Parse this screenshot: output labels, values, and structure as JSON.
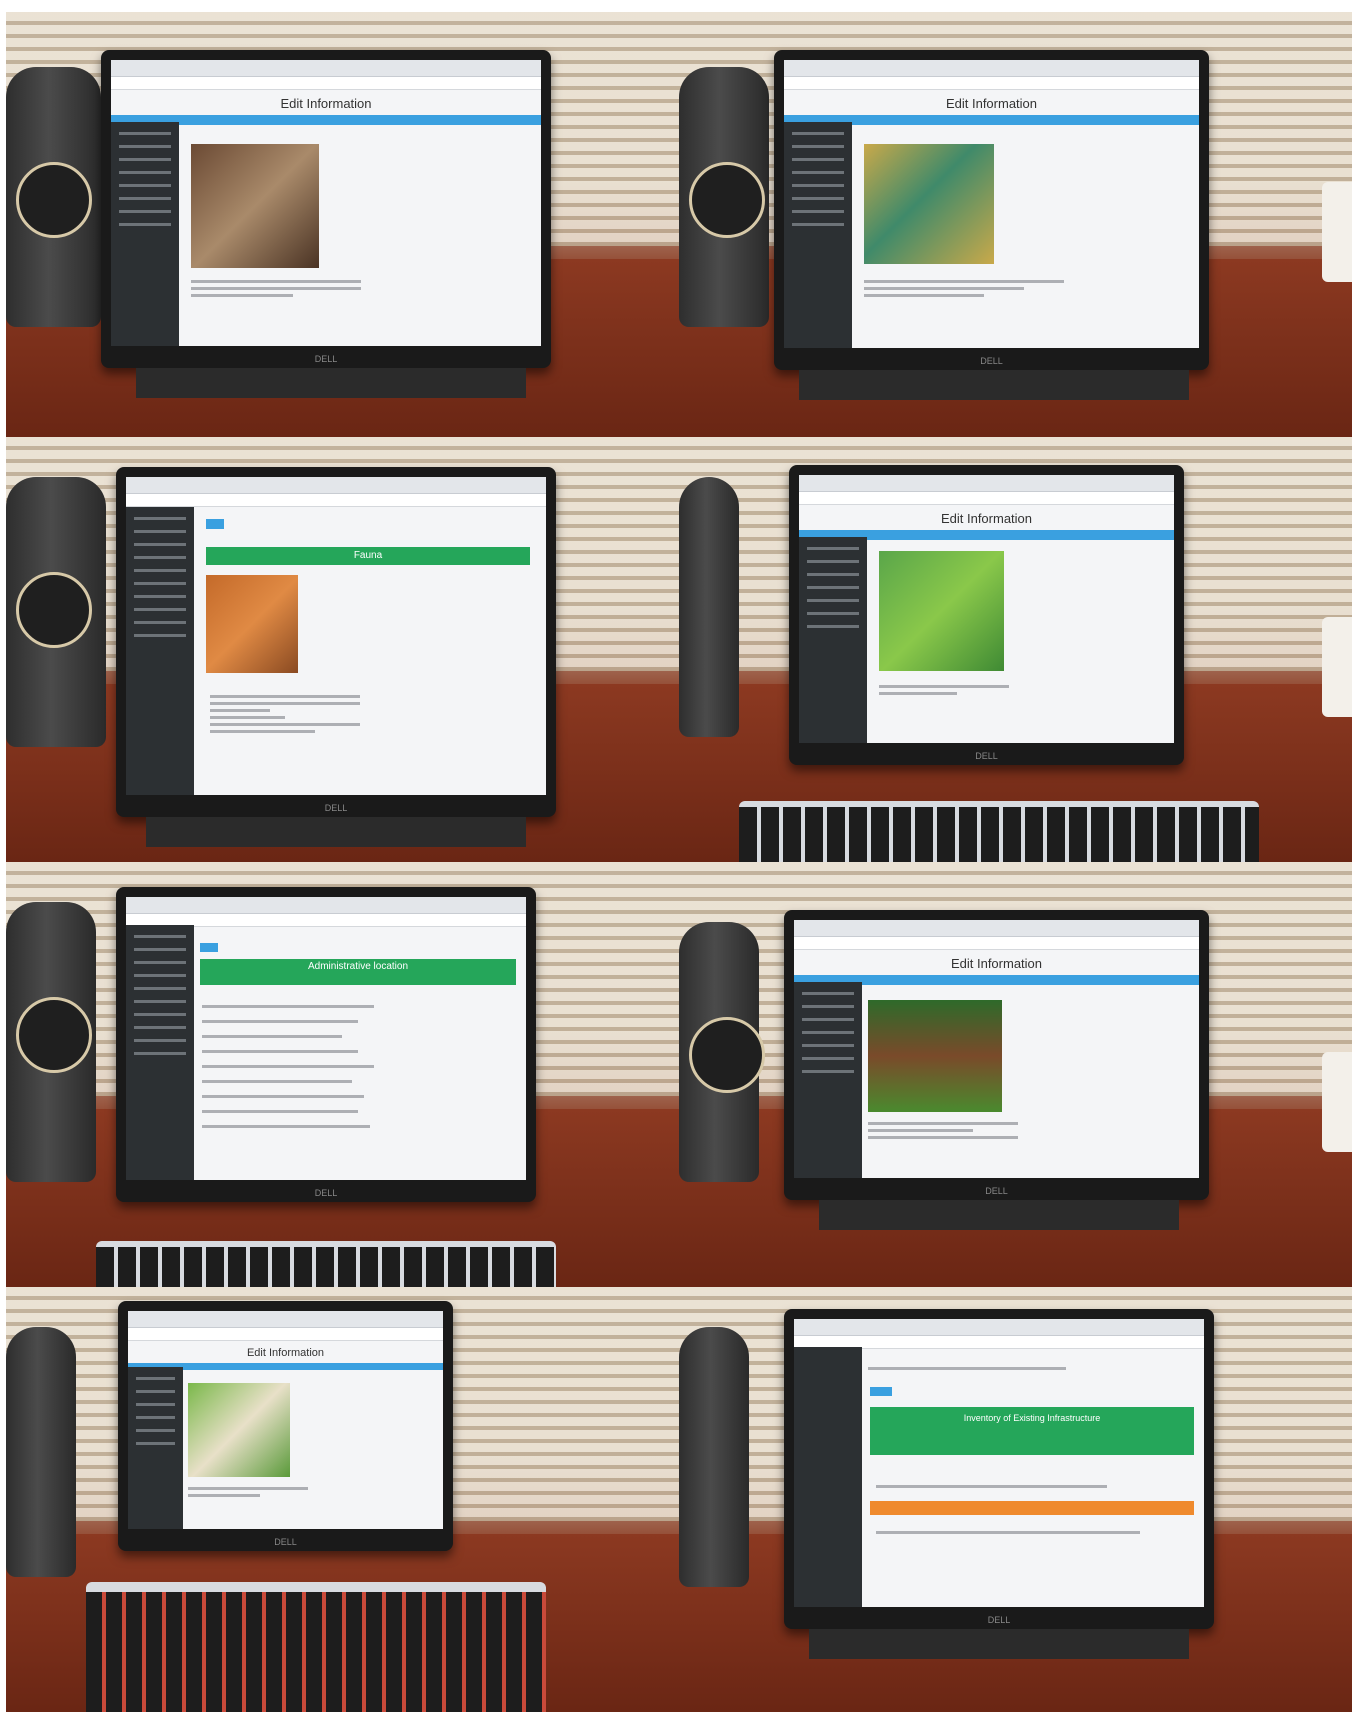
{
  "panels": [
    {
      "title": "Edit Information",
      "kind": "cave-photo",
      "image": "cave-icon"
    },
    {
      "title": "Edit Information",
      "kind": "map",
      "image": "map-icon"
    },
    {
      "title": "",
      "kind": "fauna",
      "section": "Fauna",
      "image": "deer-icon"
    },
    {
      "title": "Edit Information",
      "kind": "map",
      "image": "map-icon"
    },
    {
      "title": "",
      "kind": "list",
      "section": "Administrative location",
      "image": ""
    },
    {
      "title": "Edit Information",
      "kind": "house-photo",
      "image": "house-icon"
    },
    {
      "title": "Edit Information",
      "kind": "map",
      "image": "map-icon"
    },
    {
      "title": "",
      "kind": "table",
      "section": "Inventory of Existing Infrastructure",
      "image": ""
    }
  ],
  "brand": {
    "laptop": "DELL"
  },
  "colors": {
    "accent_blue": "#3aa0e0",
    "green": "#25a65a",
    "orange": "#ef8a2e",
    "sidebar": "#2c3033"
  }
}
